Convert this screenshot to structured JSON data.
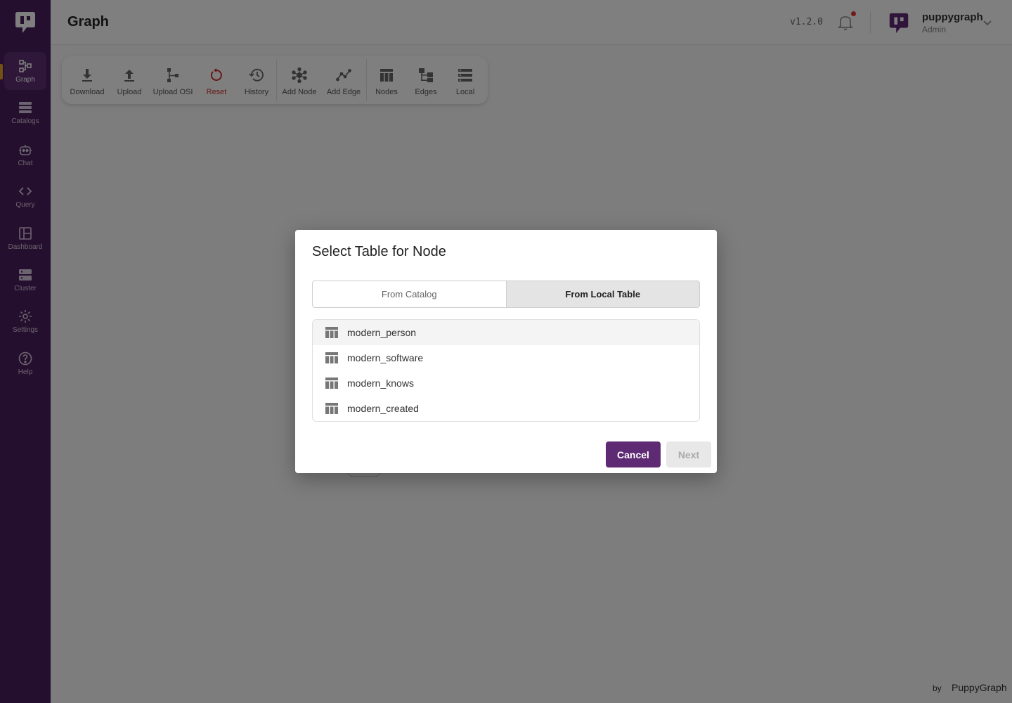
{
  "header": {
    "title": "Graph",
    "version": "v1.2.0",
    "user": {
      "name": "puppygraph",
      "role": "Admin"
    }
  },
  "sidebar": {
    "items": [
      {
        "label": "Graph",
        "icon": "graph-icon",
        "active": true
      },
      {
        "label": "Catalogs",
        "icon": "catalogs-icon"
      },
      {
        "label": "Chat",
        "icon": "robot-icon"
      },
      {
        "label": "Query",
        "icon": "code-icon"
      },
      {
        "label": "Dashboard",
        "icon": "dashboard-icon"
      },
      {
        "label": "Cluster",
        "icon": "server-icon"
      },
      {
        "label": "Settings",
        "icon": "gear-icon"
      },
      {
        "label": "Help",
        "icon": "help-icon"
      }
    ]
  },
  "toolbar": {
    "buttons": [
      {
        "label": "Download",
        "icon": "download-icon"
      },
      {
        "label": "Upload",
        "icon": "upload-icon"
      },
      {
        "label": "Upload OSI",
        "icon": "upload-osi-icon"
      },
      {
        "label": "Reset",
        "icon": "reset-icon",
        "color": "#d32f2f"
      },
      {
        "label": "History",
        "icon": "history-icon"
      },
      {
        "label": "Add Node",
        "icon": "add-node-icon"
      },
      {
        "label": "Add Edge",
        "icon": "add-edge-icon"
      },
      {
        "label": "Nodes",
        "icon": "nodes-table-icon"
      },
      {
        "label": "Edges",
        "icon": "edges-tree-icon"
      },
      {
        "label": "Local",
        "icon": "local-list-icon"
      }
    ]
  },
  "footer": {
    "by": "by",
    "brand": "PuppyGraph"
  },
  "modal": {
    "title": "Select Table for Node",
    "tabs": [
      {
        "label": "From Catalog",
        "selected": false
      },
      {
        "label": "From Local Table",
        "selected": true
      }
    ],
    "tables": [
      "modern_person",
      "modern_software",
      "modern_knows",
      "modern_created"
    ],
    "cancel_label": "Cancel",
    "next_label": "Next"
  },
  "colors": {
    "sidebar": "#4a1f5c",
    "primary": "#5e2a74",
    "reset": "#d32f2f",
    "notification_dot": "#e53935"
  }
}
